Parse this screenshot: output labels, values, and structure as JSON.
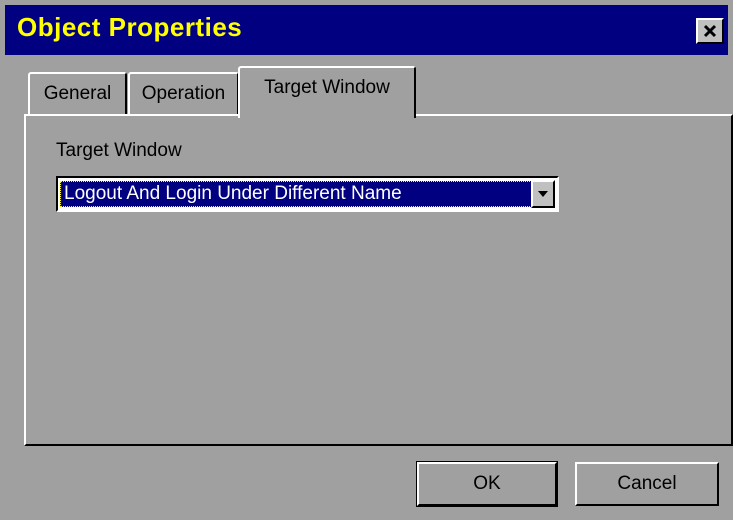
{
  "window": {
    "title": "Object Properties",
    "title_color": "#ffff00",
    "titlebar_color": "#000080",
    "close_icon": "close-icon"
  },
  "tabs": [
    {
      "label": "General",
      "active": false
    },
    {
      "label": "Operation",
      "active": false
    },
    {
      "label": "Target Window",
      "active": true
    }
  ],
  "panel": {
    "field_label": "Target Window",
    "combo": {
      "value": "Logout And Login Under Different Name",
      "icon": "chevron-down-icon"
    }
  },
  "buttons": {
    "ok_label": "OK",
    "cancel_label": "Cancel"
  }
}
